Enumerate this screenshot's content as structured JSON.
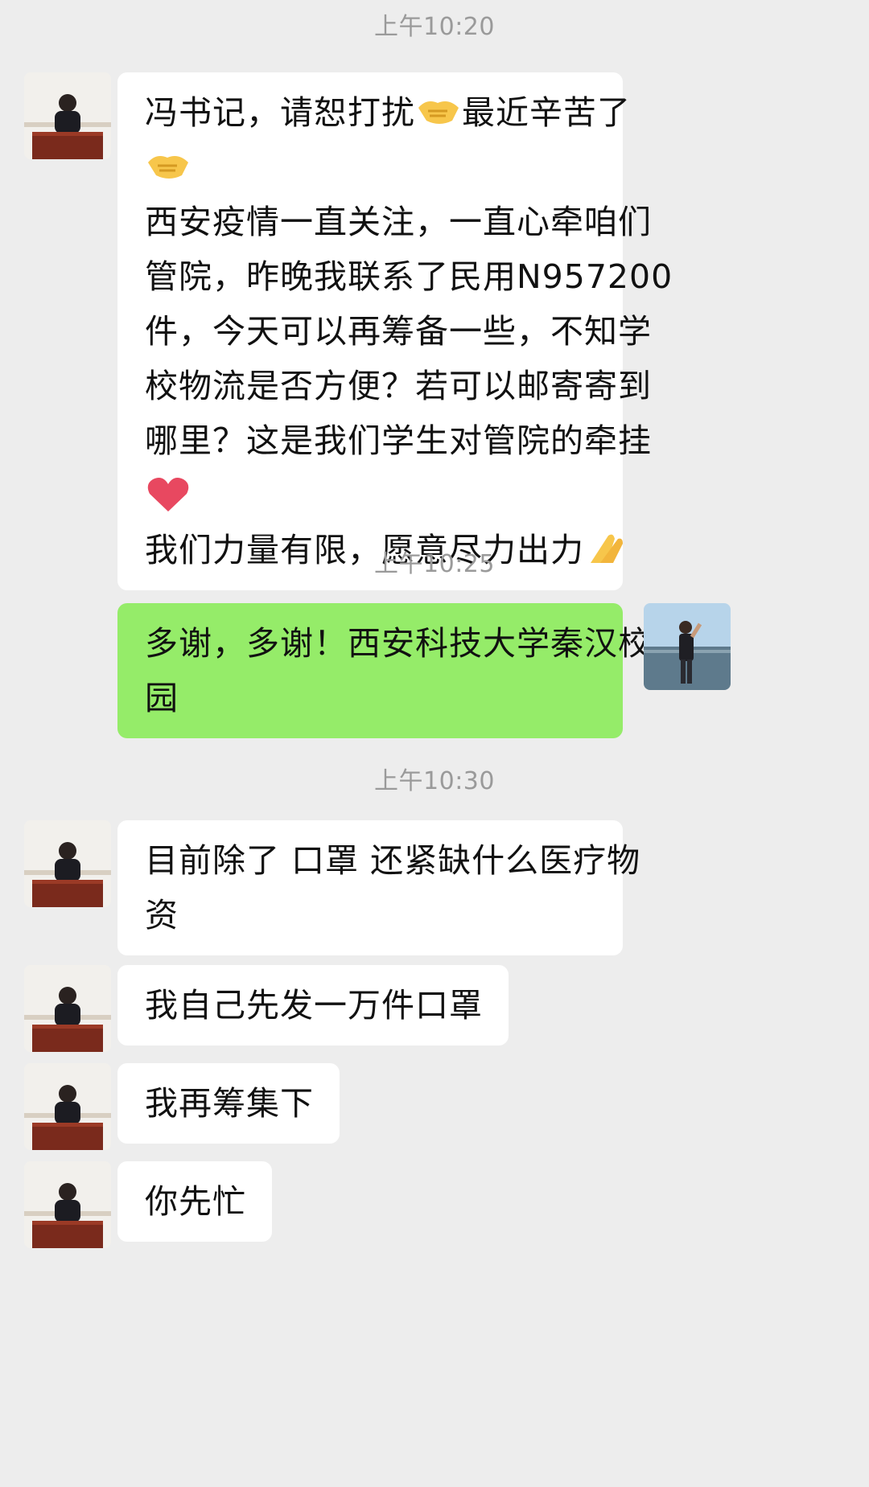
{
  "chat": {
    "timestamps": [
      "上午10:20",
      "上午10:25",
      "上午10:30"
    ],
    "msg1": {
      "l1": "冯书记，请恕打扰",
      "l1b": "最近辛苦了",
      "l3": "西安疫情一直关注，一直心牵咱们",
      "l4": "管院，昨晚我联系了民用N957200",
      "l5": "件，今天可以再筹备一些，不知学",
      "l6": "校物流是否方便？若可以邮寄寄到",
      "l7": "哪里？这是我们学生对管院的牵挂",
      "l9": "我们力量有限，愿意尽力出力",
      "emojis": [
        "handshake-emoji",
        "heart-emoji",
        "clapping-hands-emoji"
      ]
    },
    "msg2": {
      "l1": "多谢，多谢！西安科技大学秦汉校",
      "l2": "园"
    },
    "msg3": {
      "l1": "目前除了 口罩 还紧缺什么医疗物",
      "l2": "资"
    },
    "msg4": "我自己先发一万件口罩",
    "msg5": "我再筹集下",
    "msg6": "你先忙"
  },
  "colors": {
    "background": "#ededed",
    "incoming_bubble": "#ffffff",
    "outgoing_bubble": "#95ec69",
    "timestamp_text": "#9a9a9a"
  }
}
